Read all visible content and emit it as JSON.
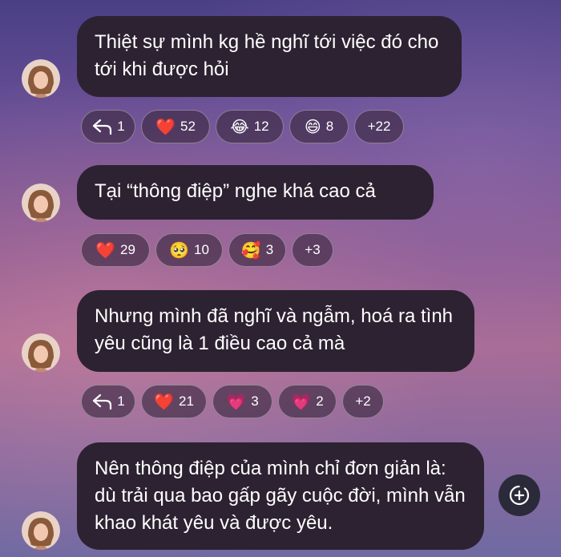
{
  "messages": [
    {
      "text": "Thiệt sự mình kg hề nghĩ tới việc đó cho tới khi được hỏi",
      "reactions": [
        {
          "type": "reply-icon",
          "count": "1"
        },
        {
          "emoji": "❤️",
          "count": "52"
        },
        {
          "emoji": "😂",
          "count": "12"
        },
        {
          "emoji": "😄",
          "count": "8"
        },
        {
          "more": "+22"
        }
      ]
    },
    {
      "text": "Tại “thông điệp” nghe khá cao cả",
      "reactions": [
        {
          "emoji": "❤️",
          "count": "29"
        },
        {
          "emoji": "🥺",
          "count": "10"
        },
        {
          "emoji": "🥰",
          "count": "3"
        },
        {
          "more": "+3"
        }
      ]
    },
    {
      "text": "Nhưng mình đã nghĩ và ngẫm, hoá ra tình yêu cũng là 1 điều cao cả mà",
      "reactions": [
        {
          "type": "reply-icon",
          "count": "1"
        },
        {
          "emoji": "❤️",
          "count": "21"
        },
        {
          "emoji": "💗",
          "count": "3"
        },
        {
          "emoji": "💗",
          "count": "2"
        },
        {
          "more": "+2"
        }
      ]
    },
    {
      "text": "Nên thông điệp của mình chỉ đơn giản là: dù trải qua bao gấp gãy cuộc đời, mình  vẫn khao khát yêu và được yêu."
    }
  ],
  "colors": {
    "bubble": "#2d2231",
    "text": "#ffffff"
  }
}
